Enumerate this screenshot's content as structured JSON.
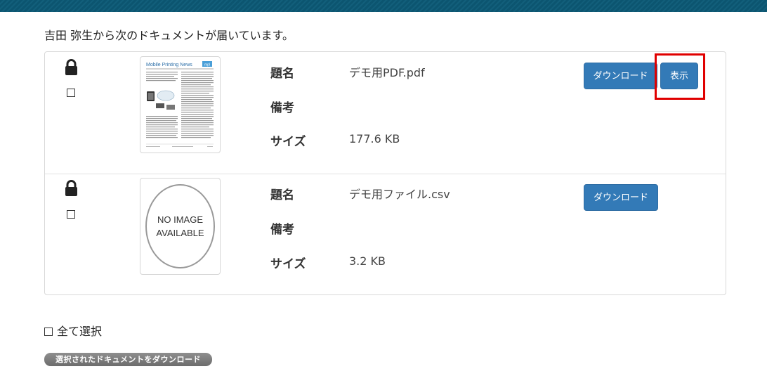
{
  "heading": "吉田 弥生から次のドキュメントが届いています。",
  "documents": [
    {
      "title_label": "題名",
      "title_value": "デモ用PDF.pdf",
      "note_label": "備考",
      "note_value": "",
      "size_label": "サイズ",
      "size_value": "177.6 KB",
      "download_label": "ダウンロード",
      "view_label": "表示",
      "thumbnail": {
        "header": "Mobile Printing News",
        "logo_text": "mpl"
      }
    },
    {
      "title_label": "題名",
      "title_value": "デモ用ファイル.csv",
      "note_label": "備考",
      "note_value": "",
      "size_label": "サイズ",
      "size_value": "3.2 KB",
      "download_label": "ダウンロード",
      "thumbnail": {
        "line1": "NO IMAGE",
        "line2": "AVAILABLE"
      }
    }
  ],
  "select_all_label": "全て選択",
  "download_selected_label": "選択されたドキュメントをダウンロード",
  "colors": {
    "topbar": "#0c5570",
    "button": "#337ab7",
    "highlight": "#e00000"
  }
}
